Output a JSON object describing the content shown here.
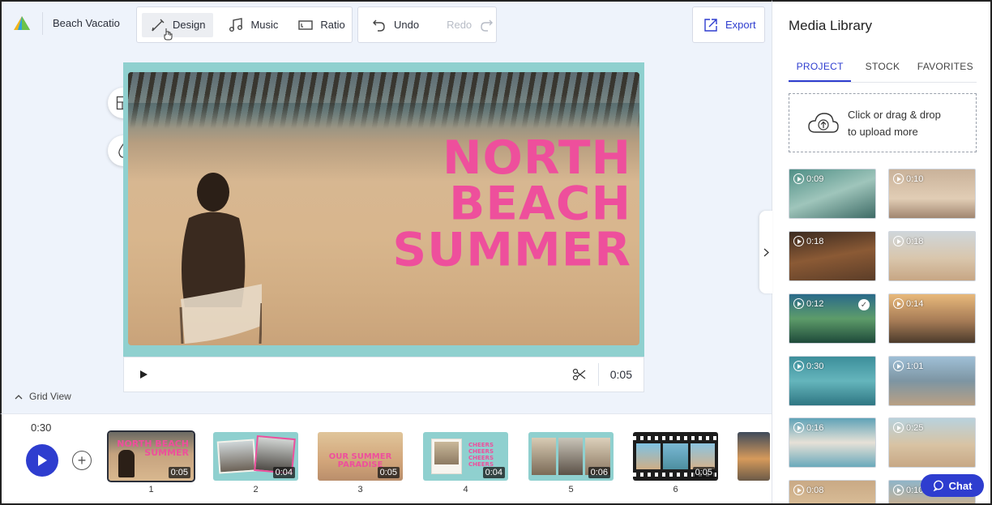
{
  "header": {
    "project_name": "Beach Vacatio",
    "design_label": "Design",
    "music_label": "Music",
    "ratio_label": "Ratio",
    "undo_label": "Undo",
    "redo_label": "Redo",
    "export_label": "Export"
  },
  "canvas": {
    "headline_lines": [
      "NORTH",
      "BEACH",
      "SUMMER"
    ],
    "headline_color": "#ee4f9c",
    "frame_color": "#8fd0cf",
    "clip_time": "0:05"
  },
  "grid_view_label": "Grid View",
  "timeline": {
    "total_time": "0:30",
    "clips": [
      {
        "number": "1",
        "duration": "0:05",
        "overlay": "NORTH BEACH SUMMER"
      },
      {
        "number": "2",
        "duration": "0:04",
        "overlay": ""
      },
      {
        "number": "3",
        "duration": "0:05",
        "overlay": "OUR SUMMER PARADISE"
      },
      {
        "number": "4",
        "duration": "0:04",
        "overlay": "CHEERS CHEERS CHEERS CHEERS"
      },
      {
        "number": "5",
        "duration": "0:06",
        "overlay": ""
      },
      {
        "number": "6",
        "duration": "0:05",
        "overlay": ""
      }
    ]
  },
  "media_library": {
    "title": "Media Library",
    "tabs": [
      "PROJECT",
      "STOCK",
      "FAVORITES"
    ],
    "active_tab": "PROJECT",
    "upload_line1": "Click or drag & drop",
    "upload_line2": "to upload more",
    "items": [
      {
        "duration": "0:09"
      },
      {
        "duration": "0:10"
      },
      {
        "duration": "0:18"
      },
      {
        "duration": "0:18"
      },
      {
        "duration": "0:12"
      },
      {
        "duration": "0:14"
      },
      {
        "duration": "0:30"
      },
      {
        "duration": "1:01"
      },
      {
        "duration": "0:16"
      },
      {
        "duration": "0:25"
      },
      {
        "duration": "0:08"
      },
      {
        "duration": "0:10"
      }
    ]
  },
  "chat_label": "Chat",
  "accent_color": "#2e3dcf"
}
